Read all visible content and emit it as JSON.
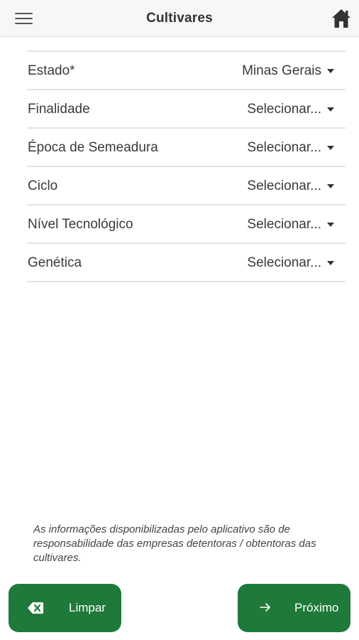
{
  "header": {
    "title": "Cultivares",
    "menu_icon": "hamburger-menu-icon",
    "home_icon": "home-icon"
  },
  "form": {
    "fields": [
      {
        "label": "Estado*",
        "value": "Minas Gerais"
      },
      {
        "label": "Finalidade",
        "value": "Selecionar..."
      },
      {
        "label": "Época de Semeadura",
        "value": "Selecionar..."
      },
      {
        "label": "Ciclo",
        "value": "Selecionar..."
      },
      {
        "label": "Nível Tecnológico",
        "value": "Selecionar..."
      },
      {
        "label": "Genética",
        "value": "Selecionar..."
      }
    ]
  },
  "disclaimer": "As informações disponibilizadas pelo aplicativo são de responsabilidade das empresas detentoras / obtentoras das cultivares.",
  "footer": {
    "clear_label": "Limpar",
    "clear_icon": "backspace-icon",
    "next_label": "Próximo",
    "next_icon": "arrow-right-icon"
  },
  "colors": {
    "primary_green": "#1f7a3a",
    "header_bg": "#f7f7f7"
  }
}
